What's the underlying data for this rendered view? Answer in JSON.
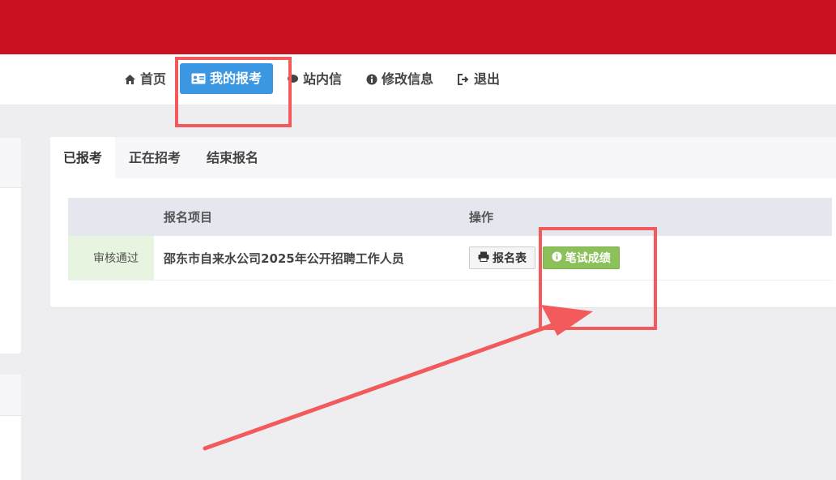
{
  "nav": {
    "items": [
      {
        "label": "首页",
        "icon": "home-icon"
      },
      {
        "label": "我的报考",
        "icon": "id-card-icon",
        "active": true
      },
      {
        "label": "站内信",
        "icon": "message-icon"
      },
      {
        "label": "修改信息",
        "icon": "info-icon"
      },
      {
        "label": "退出",
        "icon": "sign-out-icon"
      }
    ]
  },
  "tabs": [
    {
      "label": "已报考",
      "active": true
    },
    {
      "label": "正在招考"
    },
    {
      "label": "结束报名"
    }
  ],
  "table": {
    "headers": [
      "",
      "报名项目",
      "操作"
    ],
    "rows": [
      {
        "status": "审核通过",
        "project": "邵东市自来水公司2025年公开招聘工作人员",
        "actions": [
          {
            "label": "报名表",
            "icon": "print-icon"
          },
          {
            "label": "笔试成绩",
            "icon": "info-circle-icon"
          }
        ]
      }
    ]
  },
  "colors": {
    "header_red": "#cb1220",
    "active_blue": "#3c97e3",
    "success_green": "#8cc05a",
    "status_bg": "#e7f4df",
    "annotation_red": "#f25a5c"
  }
}
